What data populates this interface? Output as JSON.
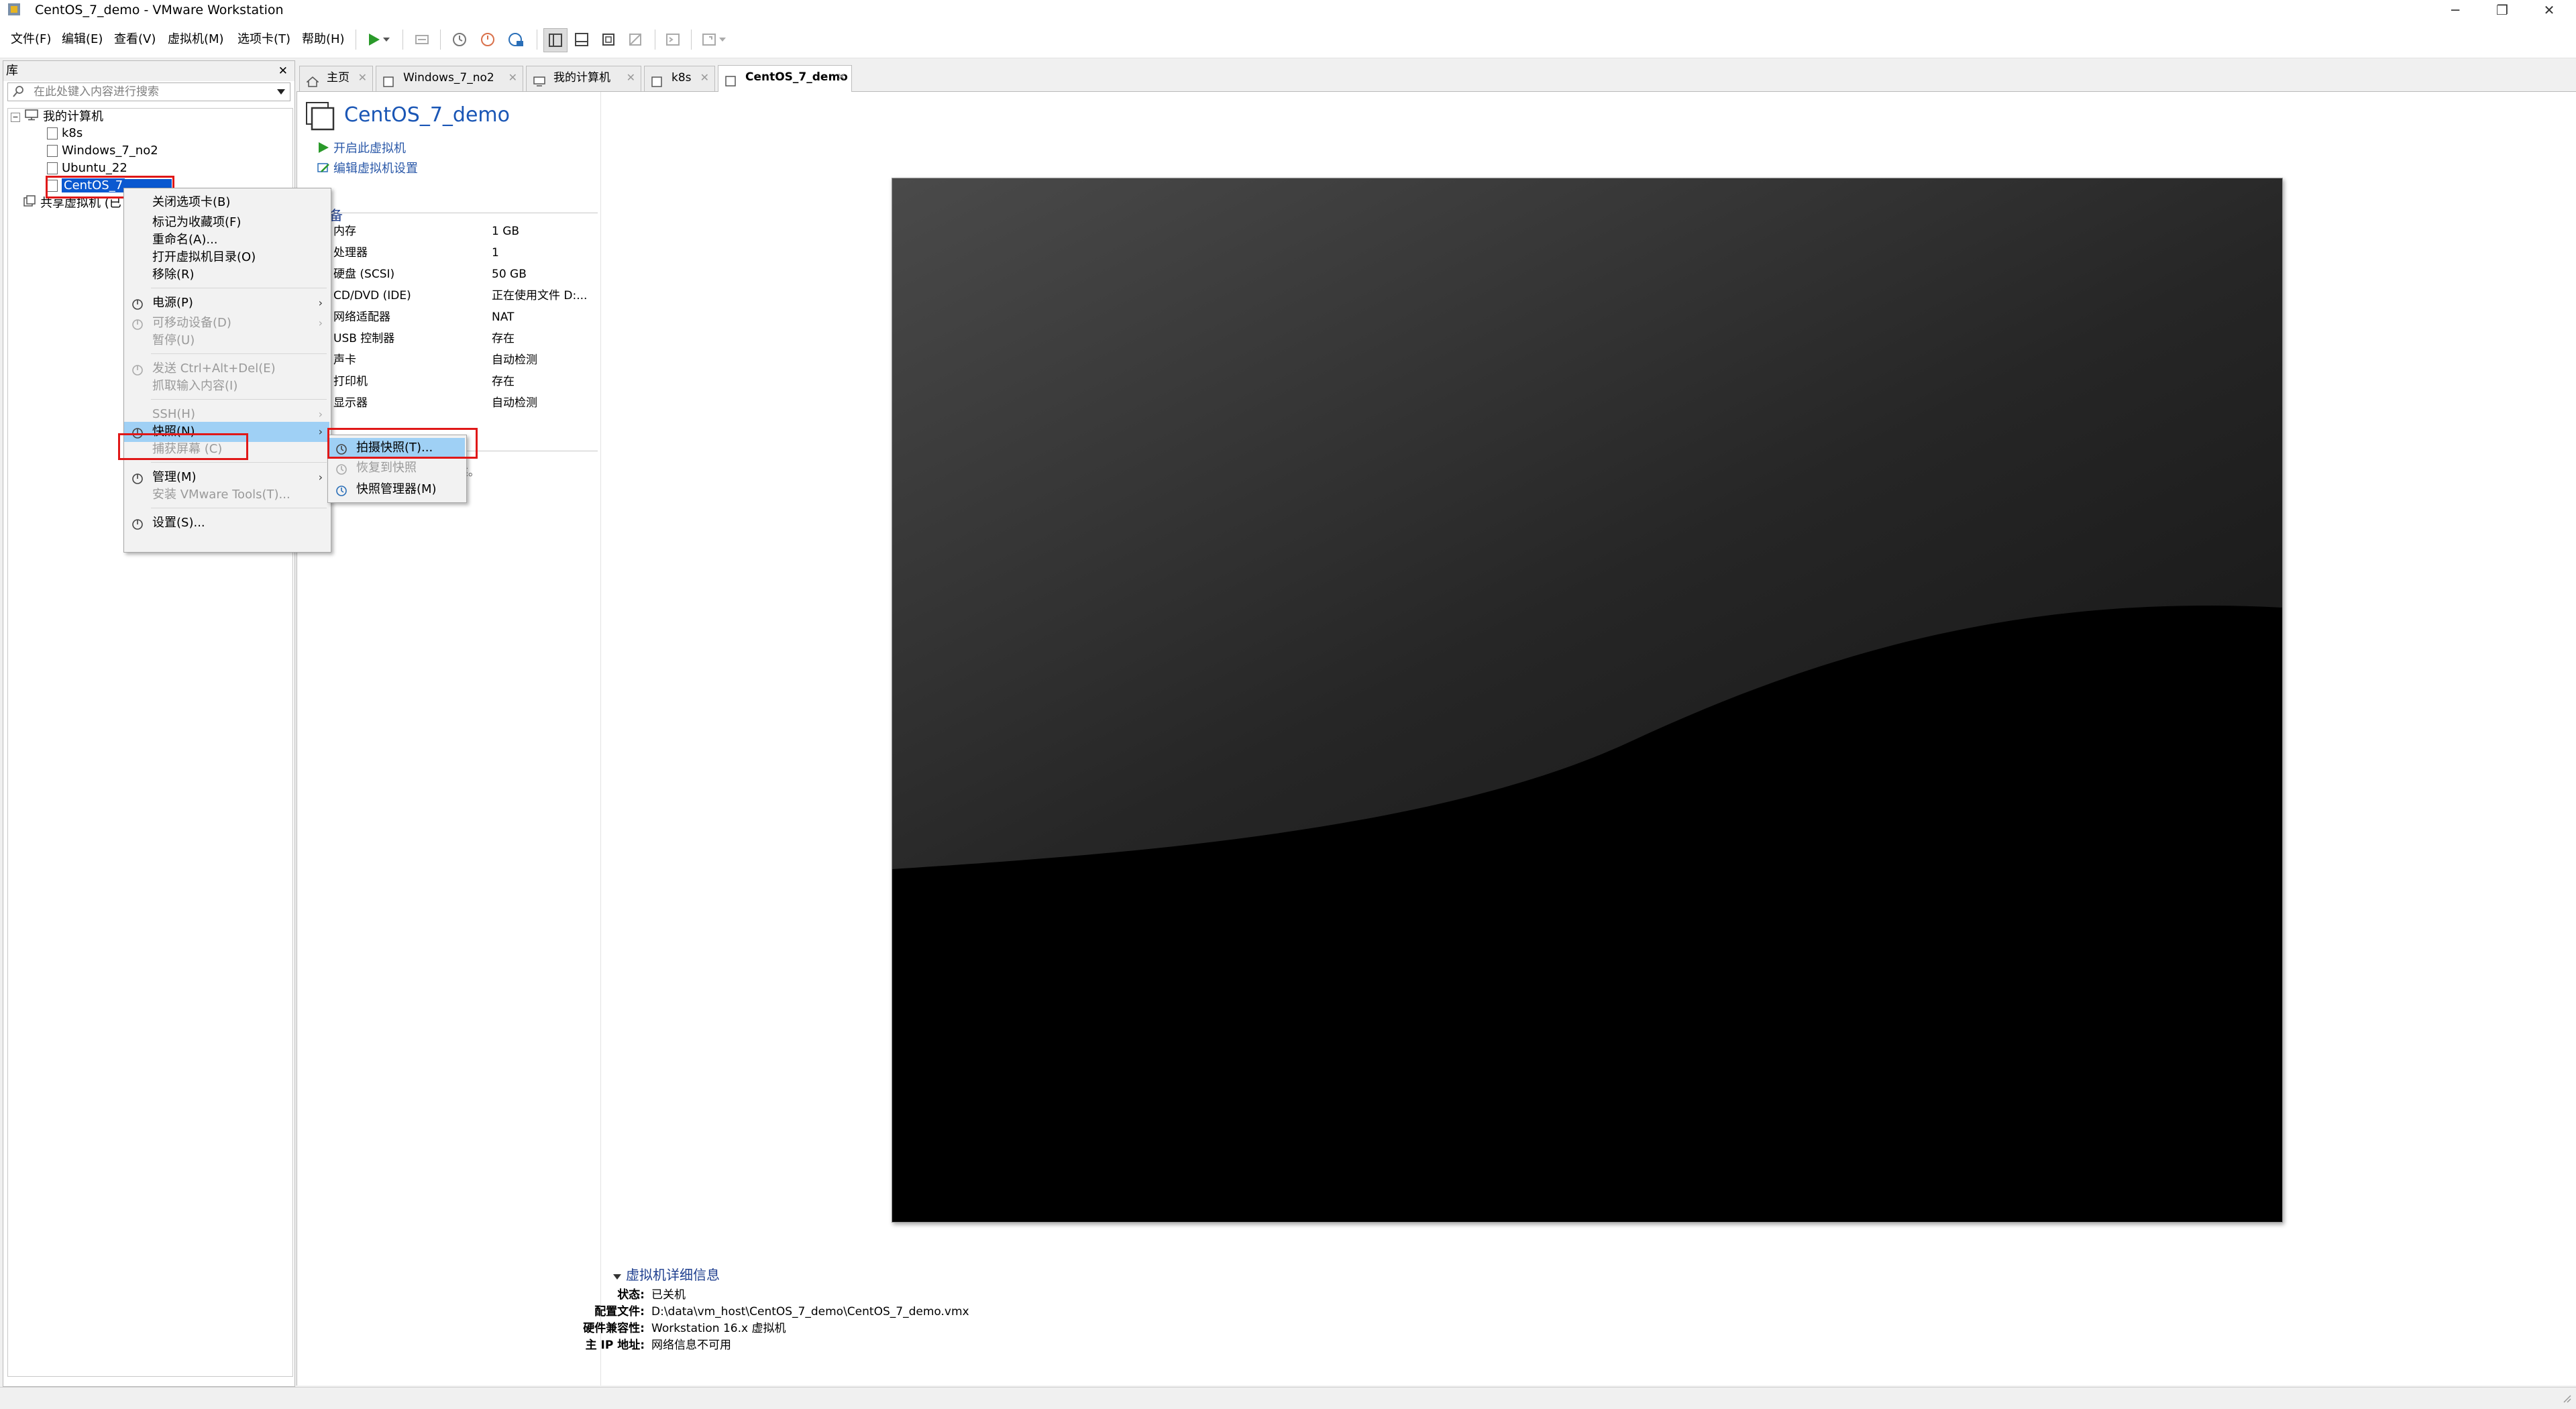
{
  "window": {
    "title": "CentOS_7_demo - VMware Workstation",
    "minimize_label": "─",
    "restore_label": "❐",
    "close_label": "✕"
  },
  "menu": [
    "文件(F)",
    "编辑(E)",
    "查看(V)",
    "虚拟机(M)",
    "选项卡(T)",
    "帮助(H)"
  ],
  "library": {
    "header": "库",
    "close_label": "✕",
    "search_placeholder": "在此处键入内容进行搜索",
    "tree": {
      "root": "我的计算机",
      "vms": [
        "k8s",
        "Windows_7_no2",
        "Ubuntu_22",
        "CentOS_7"
      ],
      "shared": "共享虚拟机 (已"
    }
  },
  "tabs": [
    {
      "label": "主页"
    },
    {
      "label": "Windows_7_no2"
    },
    {
      "label": "我的计算机"
    },
    {
      "label": "k8s"
    },
    {
      "label": "CentOS_7_demo",
      "active": true
    }
  ],
  "vm": {
    "title": "CentOS_7_demo",
    "actions": {
      "power_on": "开启此虚拟机",
      "edit_settings": "编辑虚拟机设置"
    },
    "devices_title": "设备",
    "devices": [
      {
        "name": "内存",
        "value": "1 GB"
      },
      {
        "name": "处理器",
        "value": "1"
      },
      {
        "name": "硬盘 (SCSI)",
        "value": "50 GB"
      },
      {
        "name": "CD/DVD (IDE)",
        "value": "正在使用文件 D:..."
      },
      {
        "name": "网络适配器",
        "value": "NAT"
      },
      {
        "name": "USB 控制器",
        "value": "存在"
      },
      {
        "name": "声卡",
        "value": "自动检测"
      },
      {
        "name": "打印机",
        "value": "存在"
      },
      {
        "name": "显示器",
        "value": "自动检测"
      }
    ],
    "description_fragment": "述。",
    "details": {
      "title": "虚拟机详细信息",
      "rows": [
        {
          "label": "状态:",
          "value": "已关机"
        },
        {
          "label": "配置文件:",
          "value": "D:\\data\\vm_host\\CentOS_7_demo\\CentOS_7_demo.vmx"
        },
        {
          "label": "硬件兼容性:",
          "value": "Workstation 16.x 虚拟机"
        },
        {
          "label": "主 IP 地址:",
          "value": "网络信息不可用"
        }
      ]
    }
  },
  "context_menu": {
    "items": [
      {
        "label": "关闭选项卡(B)",
        "disabled": false
      },
      {
        "label": "标记为收藏项(F)",
        "disabled": false
      },
      {
        "label": "重命名(A)...",
        "disabled": false
      },
      {
        "label": "打开虚拟机目录(O)",
        "disabled": false
      },
      {
        "label": "移除(R)",
        "disabled": false
      },
      {
        "label": "电源(P)",
        "disabled": false,
        "submenu": true
      },
      {
        "label": "可移动设备(D)",
        "disabled": true,
        "submenu": true
      },
      {
        "label": "暂停(U)",
        "disabled": true
      },
      {
        "label": "发送 Ctrl+Alt+Del(E)",
        "disabled": true
      },
      {
        "label": "抓取输入内容(I)",
        "disabled": true
      },
      {
        "label": "SSH(H)",
        "disabled": true,
        "submenu": true
      },
      {
        "label": "快照(N)",
        "disabled": false,
        "submenu": true,
        "highlighted": true
      },
      {
        "label": "捕获屏幕 (C)",
        "disabled": true
      },
      {
        "label": "管理(M)",
        "disabled": false,
        "submenu": true
      },
      {
        "label": "安装 VMware Tools(T)...",
        "disabled": true
      },
      {
        "label": "设置(S)...",
        "disabled": false
      }
    ]
  },
  "snapshot_submenu": {
    "items": [
      {
        "label": "拍摄快照(T)...",
        "disabled": false,
        "highlighted": true
      },
      {
        "label": "恢复到快照",
        "disabled": true
      },
      {
        "label": "快照管理器(M)",
        "disabled": false
      }
    ]
  },
  "colors": {
    "accent": "#1a56b5",
    "highlight": "#9fd0f5",
    "annotation": "#e01818",
    "play_green": "#2a9a2a"
  }
}
